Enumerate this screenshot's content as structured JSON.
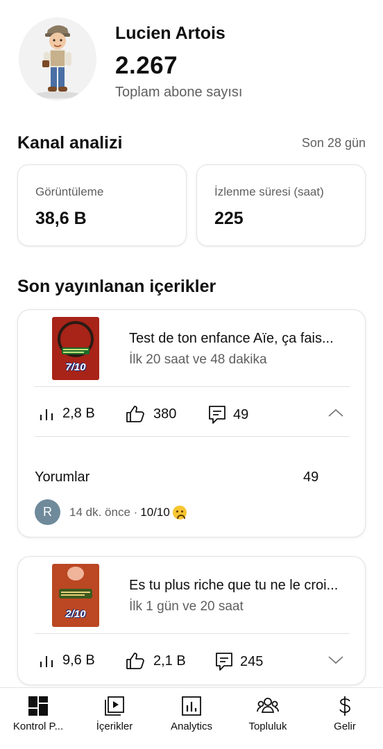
{
  "channel": {
    "name": "Lucien Artois",
    "subscriber_count": "2.267",
    "subscriber_label": "Toplam abone sayısı"
  },
  "analytics": {
    "title": "Kanal analizi",
    "period": "Son 28 gün",
    "views": {
      "label": "Görüntüleme",
      "value": "38,6 B"
    },
    "watch_time": {
      "label": "İzlenme süresi (saat)",
      "value": "225"
    }
  },
  "recent": {
    "title": "Son yayınlanan içerikler",
    "videos": [
      {
        "title": "Test de ton enfance  Aïe, ça fais...",
        "subtitle": "İlk 20 saat ve 48 dakika",
        "thumb_label": "7/10",
        "views": "2,8 B",
        "likes": "380",
        "comments": "49",
        "expanded": true,
        "comments_label": "Yorumlar",
        "comments_count": "49",
        "latest_comment": {
          "avatar_letter": "R",
          "time": "14 dk. önce ·",
          "text": "10/10"
        }
      },
      {
        "title": "Es tu plus riche que tu ne le croi...",
        "subtitle": "İlk 1 gün ve 20 saat",
        "thumb_label": "2/10",
        "views": "9,6 B",
        "likes": "2,1 B",
        "comments": "245",
        "expanded": false
      }
    ]
  },
  "nav": [
    {
      "label": "Kontrol P...",
      "icon": "dashboard-icon"
    },
    {
      "label": "İçerikler",
      "icon": "content-icon"
    },
    {
      "label": "Analytics",
      "icon": "analytics-icon"
    },
    {
      "label": "Topluluk",
      "icon": "community-icon"
    },
    {
      "label": "Gelir",
      "icon": "dollar-icon"
    }
  ],
  "colors": {
    "text_primary": "#0f0f0f",
    "text_secondary": "#5f5f5f",
    "card_border": "#e2e2e2",
    "commenter_avatar": "#6e8a9b",
    "thumbnail_red": "#b5281c"
  }
}
